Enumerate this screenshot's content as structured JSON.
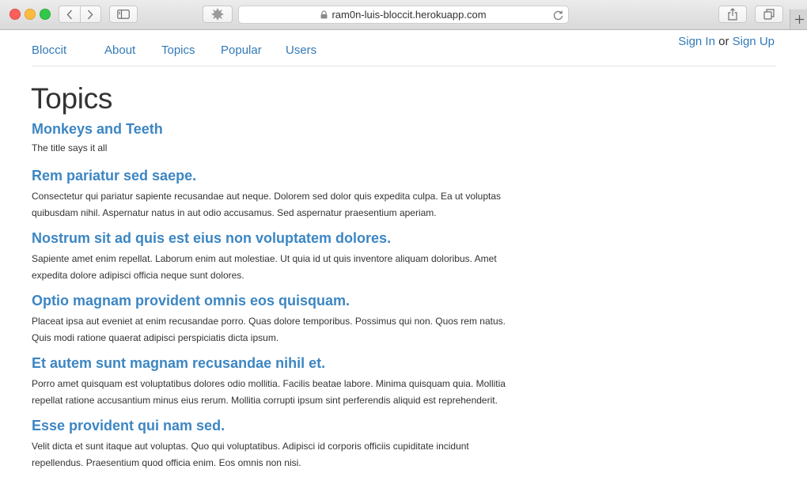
{
  "browser": {
    "url": "ram0n-luis-bloccit.herokuapp.com"
  },
  "nav": {
    "items": [
      {
        "label": "Bloccit"
      },
      {
        "label": "About"
      },
      {
        "label": "Topics"
      },
      {
        "label": "Popular"
      },
      {
        "label": "Users"
      }
    ],
    "auth": {
      "sign_in": "Sign In",
      "or": "or",
      "sign_up": "Sign Up"
    }
  },
  "page_title": "Topics",
  "topics": [
    {
      "title": "Monkeys and Teeth",
      "description": "The title says it all"
    },
    {
      "title": "Rem pariatur sed saepe.",
      "description": "Consectetur qui pariatur sapiente recusandae aut neque. Dolorem sed dolor quis expedita culpa. Ea ut voluptas quibusdam nihil. Aspernatur natus in aut odio accusamus. Sed aspernatur praesentium aperiam."
    },
    {
      "title": "Nostrum sit ad quis est eius non voluptatem dolores.",
      "description": "Sapiente amet enim repellat. Laborum enim aut molestiae. Ut quia id ut quis inventore aliquam doloribus. Amet expedita dolore adipisci officia neque sunt dolores."
    },
    {
      "title": "Optio magnam provident omnis eos quisquam.",
      "description": "Placeat ipsa aut eveniet at enim recusandae porro. Quas dolore temporibus. Possimus qui non. Quos rem natus. Quis modi ratione quaerat adipisci perspiciatis dicta ipsum."
    },
    {
      "title": "Et autem sunt magnam recusandae nihil et.",
      "description": "Porro amet quisquam est voluptatibus dolores odio mollitia. Facilis beatae labore. Minima quisquam quia. Mollitia repellat ratione accusantium minus eius rerum. Mollitia corrupti ipsum sint perferendis aliquid est reprehenderit."
    },
    {
      "title": "Esse provident qui nam sed.",
      "description": "Velit dicta et sunt itaque aut voluptas. Quo qui voluptatibus. Adipisci id corporis officiis cupiditate incidunt repellendus. Praesentium quod officia enim. Eos omnis non nisi."
    }
  ]
}
